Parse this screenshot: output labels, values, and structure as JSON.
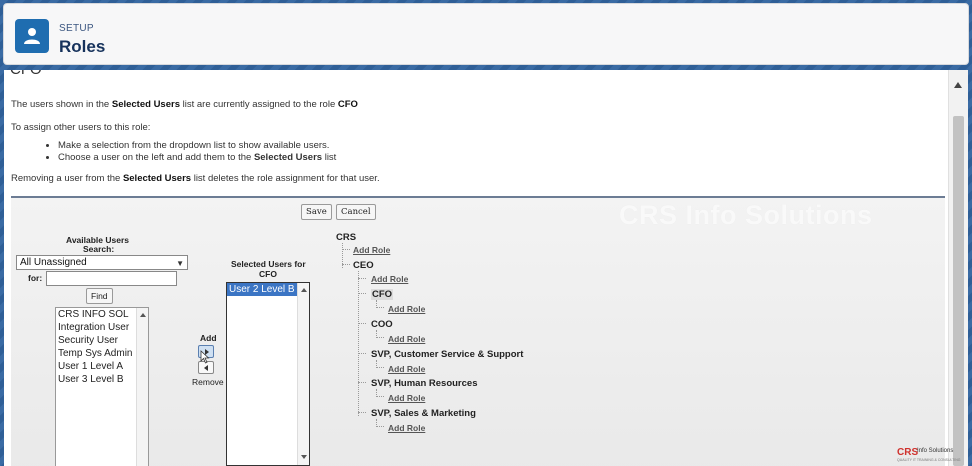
{
  "header": {
    "setup_label": "SETUP",
    "title": "Roles"
  },
  "content": {
    "cut_title": "CFO",
    "assigned_text_prefix": "The users shown in the ",
    "assigned_text_bold": "Selected Users",
    "assigned_text_middle": " list are currently assigned to the role ",
    "assigned_role": "CFO",
    "assign_intro": "To assign other users to this role:",
    "bullets": [
      "Make a selection from the dropdown list to show available users.",
      {
        "prefix": "Choose a user on the left and add them to the ",
        "bold": "Selected Users",
        "suffix": " list"
      }
    ],
    "removing_prefix": "Removing a user from the ",
    "removing_bold": "Selected Users",
    "removing_suffix": " list deletes the role assignment for that user."
  },
  "panel": {
    "watermark": "CRS Info Solutions",
    "save_label": "Save",
    "cancel_label": "Cancel",
    "available_label": "Available Users",
    "search_label": "Search:",
    "search_select_value": "All Unassigned",
    "for_label": "for:",
    "find_label": "Find",
    "available_users": [
      "CRS INFO SOL",
      "Integration User",
      "Security User",
      "Temp Sys Admin",
      "User 1 Level A",
      "User 3 Level B"
    ],
    "add_label": "Add",
    "remove_label": "Remove",
    "selected_label_line1": "Selected Users for",
    "selected_label_line2": "CFO",
    "selected_users": [
      "User 2 Level B"
    ]
  },
  "tree": {
    "root": "CRS",
    "add_role": "Add Role",
    "ceo": "CEO",
    "cfo": "CFO",
    "coo": "COO",
    "svp_cs": "SVP, Customer Service & Support",
    "svp_hr": "SVP, Human Resources",
    "svp_sales": "SVP, Sales & Marketing"
  },
  "logo": {
    "brand": "CRS",
    "name": "Info Solutions",
    "tagline": "QUALITY IT TRAINING & CONSULTING"
  },
  "colors": {
    "accent": "#1f6db0",
    "title": "#16325c",
    "selection": "#3b75c4",
    "logo_red": "#d0312d"
  }
}
